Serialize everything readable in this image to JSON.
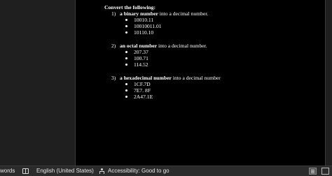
{
  "document": {
    "heading": "Convert the following:",
    "questions": [
      {
        "number": "1)",
        "bold": "a binary number",
        "rest": " into a decimal number.",
        "items": [
          "10010.11",
          "10010011.01",
          "10110.10"
        ]
      },
      {
        "number": "2)",
        "bold": "an octal number",
        "rest": " into a decimal number.",
        "items": [
          "207.37",
          "100.71",
          "114.52"
        ]
      },
      {
        "number": "3)",
        "bold": "a hexadecimal number",
        "rest": " into a decimal number",
        "items": [
          "1CF.7D",
          "7E7. 8F",
          "2A47.1E"
        ]
      }
    ]
  },
  "statusbar": {
    "word_count": "words",
    "proofing_icon": "book-icon",
    "language": "English (United States)",
    "accessibility_icon": "accessibility-icon",
    "accessibility": "Accessibility: Good to go",
    "view_print": "print-layout-icon",
    "view_web": "web-layout-icon"
  },
  "colors": {
    "page_bg": "#000000",
    "app_bg": "#1f1f1f",
    "statusbar_bg": "#2b2b2b",
    "text": "#ffffff"
  }
}
